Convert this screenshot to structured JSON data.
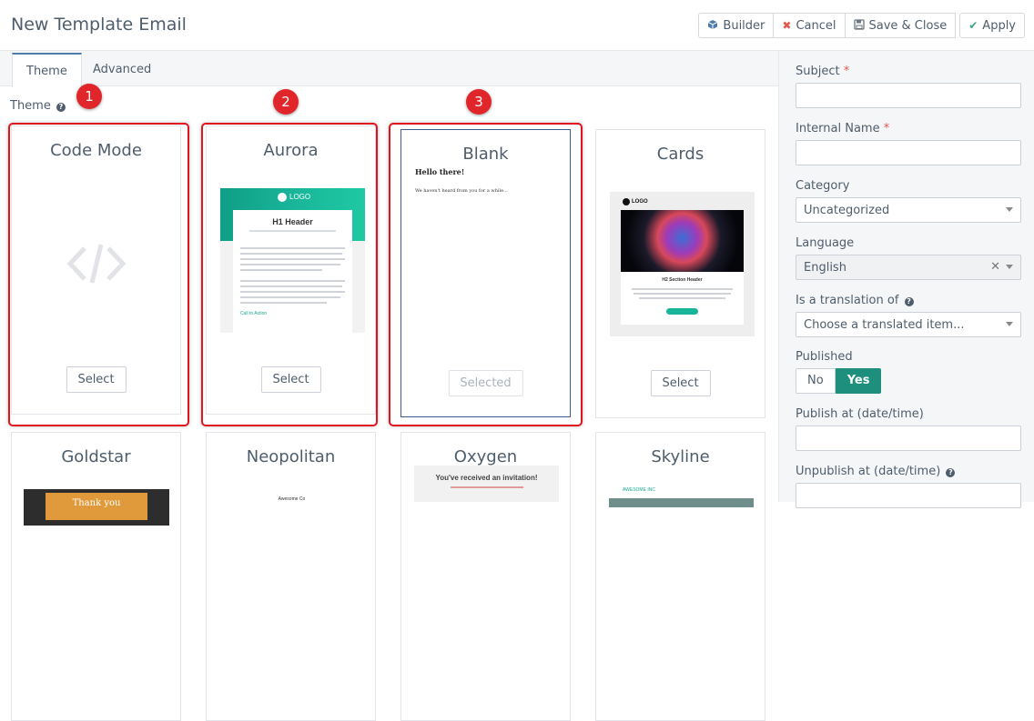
{
  "header": {
    "title": "New Template Email",
    "buttons": {
      "builder": "Builder",
      "cancel": "Cancel",
      "save_close": "Save & Close",
      "apply": "Apply"
    }
  },
  "tabs": [
    {
      "label": "Theme"
    },
    {
      "label": "Advanced"
    }
  ],
  "theme_section": {
    "label": "Theme"
  },
  "markers": [
    "1",
    "2",
    "3"
  ],
  "themes": [
    {
      "name": "Code Mode",
      "button": "Select"
    },
    {
      "name": "Aurora",
      "button": "Select"
    },
    {
      "name": "Blank",
      "button": "Selected"
    },
    {
      "name": "Cards",
      "button": "Select"
    },
    {
      "name": "Goldstar"
    },
    {
      "name": "Neopolitan"
    },
    {
      "name": "Oxygen"
    },
    {
      "name": "Skyline"
    }
  ],
  "thumbnails": {
    "aurora": {
      "logo": "LOGO",
      "header": "H1 Header",
      "link": "Call to Action"
    },
    "blank": {
      "heading": "Hello there!",
      "body": "We haven't heard from you for a while..."
    },
    "cards": {
      "logo": "LOGO",
      "section_header": "H2 Section Header"
    },
    "oxygen": {
      "text": "You've received an invitation!"
    },
    "neopolitan": {
      "text": "Awesome Co"
    },
    "goldstar": {
      "text": "Thank you"
    },
    "skyline": {
      "text": "AWESOME INC"
    }
  },
  "sidebar": {
    "subject": {
      "label": "Subject",
      "value": ""
    },
    "internal_name": {
      "label": "Internal Name",
      "value": ""
    },
    "category": {
      "label": "Category",
      "value": "Uncategorized"
    },
    "language": {
      "label": "Language",
      "value": "English"
    },
    "translation": {
      "label": "Is a translation of",
      "value": "Choose a translated item..."
    },
    "published": {
      "label": "Published",
      "no": "No",
      "yes": "Yes"
    },
    "publish_at": {
      "label": "Publish at (date/time)",
      "value": ""
    },
    "unpublish_at": {
      "label": "Unpublish at (date/time)",
      "value": ""
    }
  },
  "colors": {
    "accent": "#4e7dab",
    "toggle_yes": "#1d8f7c",
    "highlight_frame": "#e0141e",
    "marker": "#e0262b"
  }
}
